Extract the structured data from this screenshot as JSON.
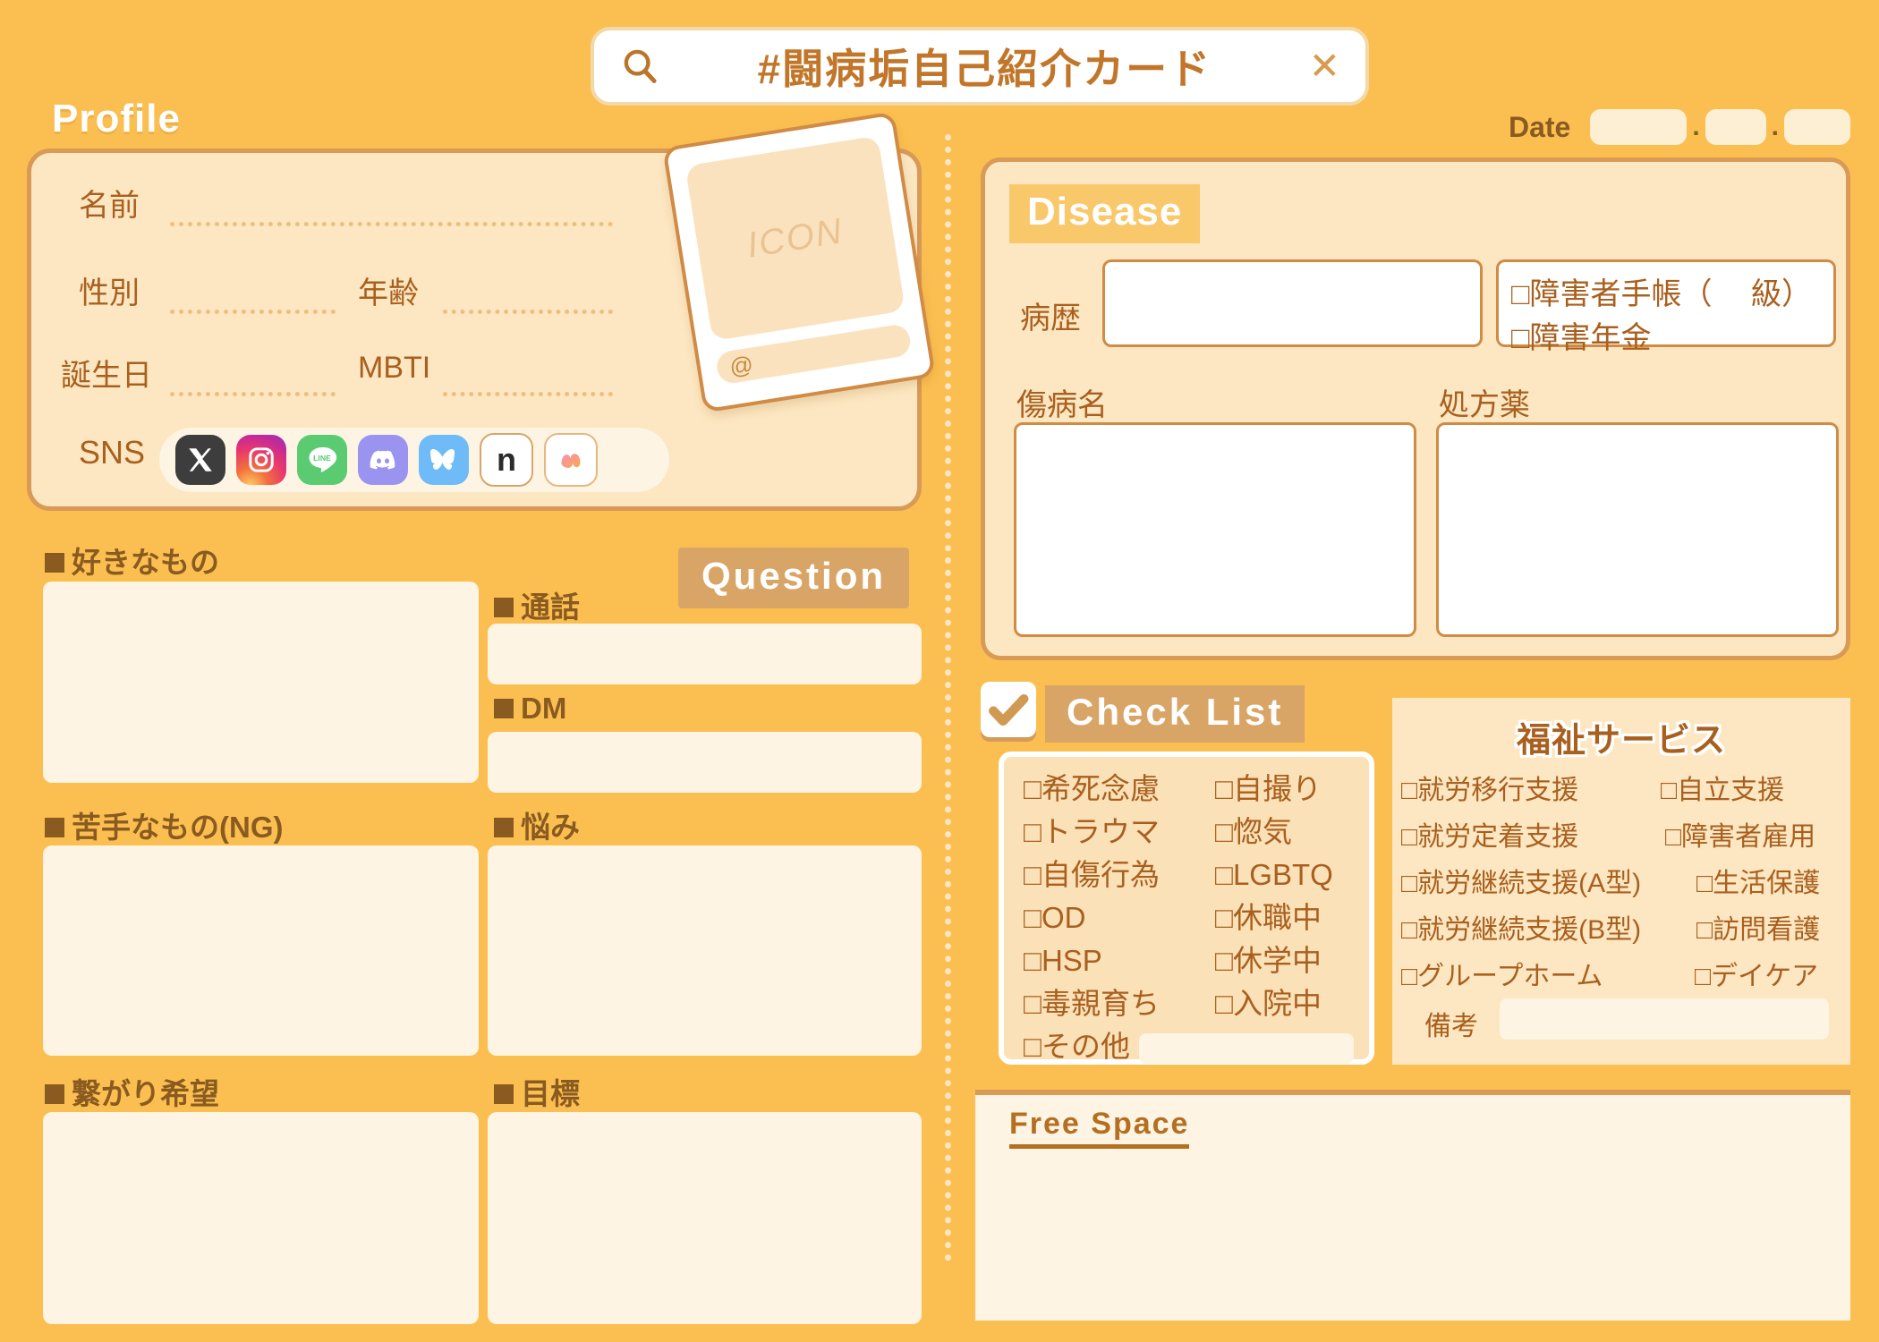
{
  "search": {
    "title": "#闘病垢自己紹介カード",
    "search_icon": "search-icon",
    "close_icon": "close-icon"
  },
  "date": {
    "label": "Date",
    "separator": ".",
    "year": "",
    "month": "",
    "day": ""
  },
  "profile": {
    "title": "Profile",
    "fields": [
      {
        "label": "名前",
        "value": ""
      },
      {
        "label": "性別",
        "value": ""
      },
      {
        "label": "年齢",
        "value": ""
      },
      {
        "label": "誕生日",
        "value": ""
      },
      {
        "label": "MBTI",
        "value": ""
      }
    ],
    "sns_label": "SNS",
    "sns_icons": [
      {
        "name": "x-twitter-icon",
        "label": "X"
      },
      {
        "name": "instagram-icon",
        "label": "Instagram"
      },
      {
        "name": "line-icon",
        "label": "LINE"
      },
      {
        "name": "discord-icon",
        "label": "Discord"
      },
      {
        "name": "bluesky-icon",
        "label": "Bluesky"
      },
      {
        "name": "note-icon",
        "label": "note"
      },
      {
        "name": "misskey-icon",
        "label": "Misskey"
      }
    ],
    "icon_card": {
      "placeholder": "ICON",
      "handle_prefix": "@",
      "handle_value": ""
    }
  },
  "left_blocks": [
    {
      "label": "好きなもの",
      "value": ""
    },
    {
      "label": "苦手なもの(NG)",
      "value": ""
    },
    {
      "label": "繋がり希望",
      "value": ""
    }
  ],
  "question": {
    "title": "Question",
    "blocks": [
      {
        "label": "通話",
        "value": ""
      },
      {
        "label": "DM",
        "value": ""
      },
      {
        "label": "悩み",
        "value": ""
      },
      {
        "label": "目標",
        "value": ""
      }
    ]
  },
  "disease": {
    "title": "Disease",
    "history_label": "病歴",
    "history_value": "",
    "certificates": [
      {
        "label": "障害者手帳（　 級）",
        "checked": false
      },
      {
        "label": "障害年金",
        "checked": false
      }
    ],
    "illness_label": "傷病名",
    "illness_value": "",
    "medicine_label": "処方薬",
    "medicine_value": ""
  },
  "checklist": {
    "title": "Check List",
    "check_icon": "checkmark-icon",
    "column_left": [
      {
        "label": "希死念慮",
        "checked": false
      },
      {
        "label": "トラウマ",
        "checked": false
      },
      {
        "label": "自傷行為",
        "checked": false
      },
      {
        "label": "OD",
        "checked": false
      },
      {
        "label": "HSP",
        "checked": false
      },
      {
        "label": "毒親育ち",
        "checked": false
      }
    ],
    "column_right": [
      {
        "label": "自撮り",
        "checked": false
      },
      {
        "label": "惚気",
        "checked": false
      },
      {
        "label": "LGBTQ",
        "checked": false
      },
      {
        "label": "休職中",
        "checked": false
      },
      {
        "label": "休学中",
        "checked": false
      },
      {
        "label": "入院中",
        "checked": false
      }
    ],
    "other_label": "その他",
    "other_value": ""
  },
  "welfare": {
    "title": "福祉サービス",
    "rows": [
      {
        "left": "就労移行支援",
        "right": "自立支援"
      },
      {
        "left": "就労定着支援",
        "right": "障害者雇用"
      },
      {
        "left": "就労継続支援(A型)",
        "right": "生活保護"
      },
      {
        "left": "就労継続支援(B型)",
        "right": "訪問看護"
      },
      {
        "left": "グループホーム",
        "right": "デイケア"
      }
    ],
    "note_label": "備考",
    "note_value": ""
  },
  "free_space": {
    "title": "Free Space",
    "value": ""
  },
  "colors": {
    "background": "#FBBF51",
    "panel": "#FCE7C2",
    "panel_border": "#D89A56",
    "field": "#FDF4E3",
    "text_brown": "#A9601F",
    "label_brown": "#8A5B20",
    "tag_brown": "#D9A567",
    "tag_orange": "#F9C86B",
    "white": "#FFFFFF"
  }
}
